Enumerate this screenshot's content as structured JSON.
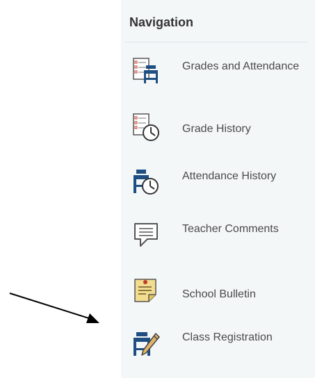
{
  "nav": {
    "title": "Navigation",
    "items": [
      {
        "label": "Grades and Attendance",
        "icon": "checklist-desk-icon"
      },
      {
        "label": "Grade History",
        "icon": "checklist-clock-icon"
      },
      {
        "label": "Attendance History",
        "icon": "desk-clock-icon"
      },
      {
        "label": "Teacher Comments",
        "icon": "comment-icon"
      },
      {
        "label": "School Bulletin",
        "icon": "bulletin-note-icon"
      },
      {
        "label": "Class Registration",
        "icon": "desk-pencil-icon"
      }
    ]
  },
  "colors": {
    "panel_bg": "#f4f7f8",
    "icon_blue": "#1f4f82",
    "label": "#4a4a4a"
  }
}
